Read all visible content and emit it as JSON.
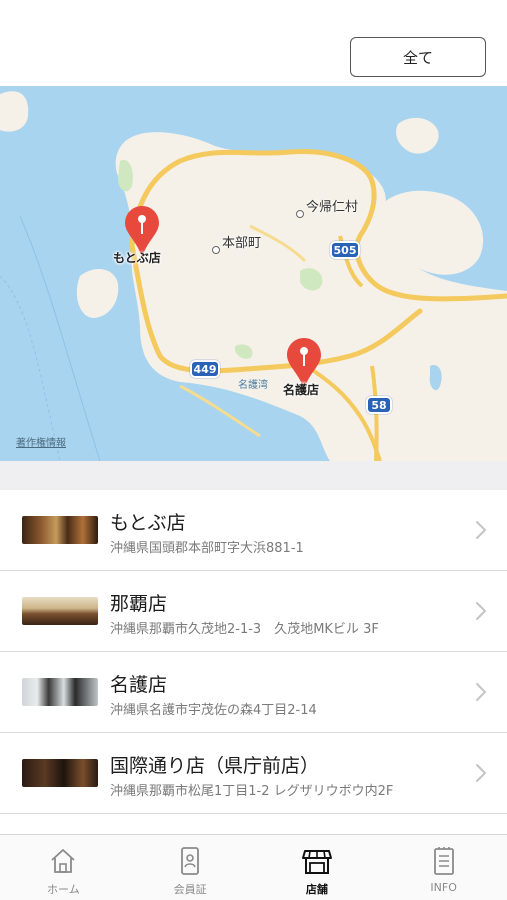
{
  "header": {
    "filter_button_label": "全て"
  },
  "map": {
    "places": [
      "今帰仁村",
      "本部町"
    ],
    "store_pins": [
      "もとぶ店",
      "名護店"
    ],
    "water_label": "名護湾",
    "route_numbers": [
      "505",
      "449",
      "58"
    ],
    "legal_label": "著作権情報",
    "colors": {
      "sea": "#a9d4ef",
      "land": "#f5f1e8",
      "road": "#f4c95d",
      "pin": "#e8493d",
      "route_shield": "#2a62b8"
    }
  },
  "stores": [
    {
      "name": "もとぶ店",
      "address": "沖縄県国頭郡本部町字大浜881-1"
    },
    {
      "name": "那覇店",
      "address": "沖縄県那覇市久茂地2-1-3　久茂地MKビル 3F"
    },
    {
      "name": "名護店",
      "address": "沖縄県名護市宇茂佐の森4丁目2-14"
    },
    {
      "name": "国際通り店（県庁前店）",
      "address": "沖縄県那覇市松尾1丁目1-2 レグザリウボウ内2F"
    }
  ],
  "tabbar": {
    "items": [
      {
        "label": "ホーム",
        "icon": "home-icon"
      },
      {
        "label": "会員証",
        "icon": "member-card-icon"
      },
      {
        "label": "店舗",
        "icon": "store-icon",
        "active": true
      },
      {
        "label": "INFO",
        "icon": "info-list-icon"
      }
    ]
  }
}
